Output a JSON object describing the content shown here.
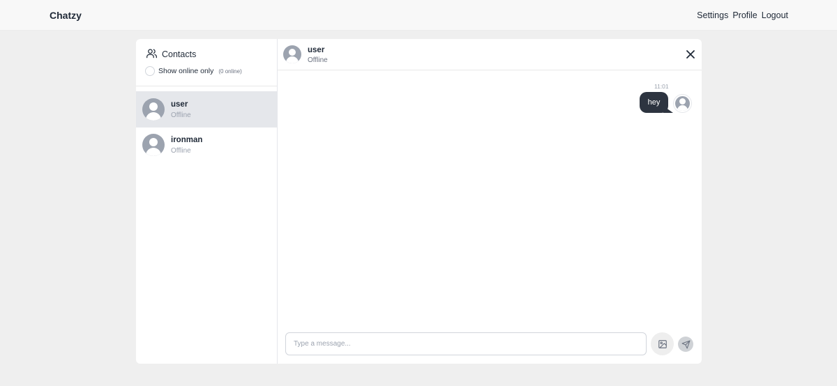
{
  "app": {
    "brand": "Chatzy"
  },
  "nav": {
    "settings": "Settings",
    "profile": "Profile",
    "logout": "Logout"
  },
  "sidebar": {
    "title": "Contacts",
    "online_filter_label": "Show online only",
    "online_count": "(0 online)",
    "contacts": [
      {
        "name": "user",
        "status": "Offline",
        "selected": true
      },
      {
        "name": "ironman",
        "status": "Offline",
        "selected": false
      }
    ]
  },
  "chat": {
    "name": "user",
    "status": "Offline",
    "messages": [
      {
        "time": "11:01",
        "text": "hey",
        "from_me": true
      }
    ],
    "composer": {
      "placeholder": "Type a message..."
    }
  },
  "icons": {
    "contacts": "users-icon",
    "close": "close-icon",
    "image": "image-icon",
    "send": "send-icon",
    "avatar": "user-avatar-icon"
  },
  "colors": {
    "bubble": "#2d3440",
    "active_contact": "#e5e7eb",
    "avatar": "#9ca3af"
  }
}
